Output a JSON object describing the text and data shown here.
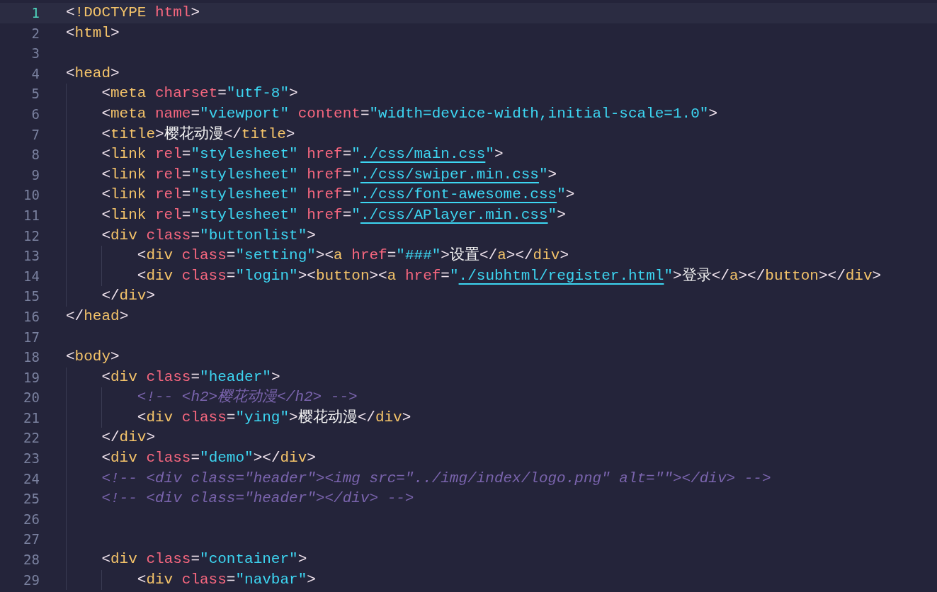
{
  "editor": {
    "lines": [
      {
        "number": "1",
        "current": true,
        "tokens": [
          {
            "kind": "punct",
            "text": "<"
          },
          {
            "kind": "doctype",
            "text": "!DOCTYPE "
          },
          {
            "kind": "attr",
            "text": "html"
          },
          {
            "kind": "punct",
            "text": ">"
          }
        ]
      },
      {
        "number": "2",
        "current": false,
        "tokens": [
          {
            "kind": "punct",
            "text": "<"
          },
          {
            "kind": "tag",
            "text": "html"
          },
          {
            "kind": "punct",
            "text": ">"
          }
        ]
      },
      {
        "number": "3",
        "current": false
      },
      {
        "number": "4",
        "current": false,
        "tokens": [
          {
            "kind": "punct",
            "text": "<"
          },
          {
            "kind": "tag",
            "text": "head"
          },
          {
            "kind": "punct",
            "text": ">"
          }
        ],
        "children": [
          {
            "number": "5",
            "current": false,
            "tokens": [
              {
                "kind": "punct",
                "text": "<"
              },
              {
                "kind": "tag",
                "text": "meta "
              },
              {
                "kind": "attr",
                "text": "charset"
              },
              {
                "kind": "punct",
                "text": "="
              },
              {
                "kind": "string",
                "text": "\"utf-8\""
              },
              {
                "kind": "punct",
                "text": ">"
              }
            ]
          },
          {
            "number": "6",
            "current": false,
            "tokens": [
              {
                "kind": "punct",
                "text": "<"
              },
              {
                "kind": "tag",
                "text": "meta "
              },
              {
                "kind": "attr",
                "text": "name"
              },
              {
                "kind": "punct",
                "text": "="
              },
              {
                "kind": "string",
                "text": "\"viewport\" "
              },
              {
                "kind": "attr",
                "text": "content"
              },
              {
                "kind": "punct",
                "text": "="
              },
              {
                "kind": "string",
                "text": "\"width=device-width,initial-scale=1.0\""
              },
              {
                "kind": "punct",
                "text": ">"
              }
            ]
          },
          {
            "number": "7",
            "current": false,
            "tokens": [
              {
                "kind": "punct",
                "text": "<"
              },
              {
                "kind": "tag",
                "text": "title"
              },
              {
                "kind": "punct",
                "text": ">"
              },
              {
                "kind": "text",
                "text": "樱花动漫"
              },
              {
                "kind": "punct",
                "text": "</"
              },
              {
                "kind": "tag",
                "text": "title"
              },
              {
                "kind": "punct",
                "text": ">"
              }
            ]
          },
          {
            "number": "8",
            "current": false,
            "tokens": [
              {
                "kind": "punct",
                "text": "<"
              },
              {
                "kind": "tag",
                "text": "link "
              },
              {
                "kind": "attr",
                "text": "rel"
              },
              {
                "kind": "punct",
                "text": "="
              },
              {
                "kind": "string",
                "text": "\"stylesheet\" "
              },
              {
                "kind": "attr",
                "text": "href"
              },
              {
                "kind": "punct",
                "text": "="
              },
              {
                "kind": "string",
                "text": "\""
              },
              {
                "kind": "link",
                "text": "./css/main.css"
              },
              {
                "kind": "string",
                "text": "\""
              },
              {
                "kind": "punct",
                "text": ">"
              }
            ]
          },
          {
            "number": "9",
            "current": false,
            "tokens": [
              {
                "kind": "punct",
                "text": "<"
              },
              {
                "kind": "tag",
                "text": "link "
              },
              {
                "kind": "attr",
                "text": "rel"
              },
              {
                "kind": "punct",
                "text": "="
              },
              {
                "kind": "string",
                "text": "\"stylesheet\" "
              },
              {
                "kind": "attr",
                "text": "href"
              },
              {
                "kind": "punct",
                "text": "="
              },
              {
                "kind": "string",
                "text": "\""
              },
              {
                "kind": "link",
                "text": "./css/swiper.min.css"
              },
              {
                "kind": "string",
                "text": "\""
              },
              {
                "kind": "punct",
                "text": ">"
              }
            ]
          },
          {
            "number": "10",
            "current": false,
            "tokens": [
              {
                "kind": "punct",
                "text": "<"
              },
              {
                "kind": "tag",
                "text": "link "
              },
              {
                "kind": "attr",
                "text": "rel"
              },
              {
                "kind": "punct",
                "text": "="
              },
              {
                "kind": "string",
                "text": "\"stylesheet\" "
              },
              {
                "kind": "attr",
                "text": "href"
              },
              {
                "kind": "punct",
                "text": "="
              },
              {
                "kind": "string",
                "text": "\""
              },
              {
                "kind": "link",
                "text": "./css/font-awesome.css"
              },
              {
                "kind": "string",
                "text": "\""
              },
              {
                "kind": "punct",
                "text": ">"
              }
            ]
          },
          {
            "number": "11",
            "current": false,
            "tokens": [
              {
                "kind": "punct",
                "text": "<"
              },
              {
                "kind": "tag",
                "text": "link "
              },
              {
                "kind": "attr",
                "text": "rel"
              },
              {
                "kind": "punct",
                "text": "="
              },
              {
                "kind": "string",
                "text": "\"stylesheet\" "
              },
              {
                "kind": "attr",
                "text": "href"
              },
              {
                "kind": "punct",
                "text": "="
              },
              {
                "kind": "string",
                "text": "\""
              },
              {
                "kind": "link",
                "text": "./css/APlayer.min.css"
              },
              {
                "kind": "string",
                "text": "\""
              },
              {
                "kind": "punct",
                "text": ">"
              }
            ]
          },
          {
            "number": "12",
            "current": false,
            "tokens": [
              {
                "kind": "punct",
                "text": "<"
              },
              {
                "kind": "tag",
                "text": "div "
              },
              {
                "kind": "attr",
                "text": "class"
              },
              {
                "kind": "punct",
                "text": "="
              },
              {
                "kind": "string",
                "text": "\"buttonlist\""
              },
              {
                "kind": "punct",
                "text": ">"
              }
            ],
            "children": [
              {
                "number": "13",
                "current": false,
                "tokens": [
                  {
                    "kind": "punct",
                    "text": "<"
                  },
                  {
                    "kind": "tag",
                    "text": "div "
                  },
                  {
                    "kind": "attr",
                    "text": "class"
                  },
                  {
                    "kind": "punct",
                    "text": "="
                  },
                  {
                    "kind": "string",
                    "text": "\"setting\""
                  },
                  {
                    "kind": "punct",
                    "text": "><"
                  },
                  {
                    "kind": "tag",
                    "text": "a "
                  },
                  {
                    "kind": "attr",
                    "text": "href"
                  },
                  {
                    "kind": "punct",
                    "text": "="
                  },
                  {
                    "kind": "string",
                    "text": "\"###\""
                  },
                  {
                    "kind": "punct",
                    "text": ">"
                  },
                  {
                    "kind": "text",
                    "text": "设置"
                  },
                  {
                    "kind": "punct",
                    "text": "</"
                  },
                  {
                    "kind": "tag",
                    "text": "a"
                  },
                  {
                    "kind": "punct",
                    "text": "></"
                  },
                  {
                    "kind": "tag",
                    "text": "div"
                  },
                  {
                    "kind": "punct",
                    "text": ">"
                  }
                ]
              },
              {
                "number": "14",
                "current": false,
                "tokens": [
                  {
                    "kind": "punct",
                    "text": "<"
                  },
                  {
                    "kind": "tag",
                    "text": "div "
                  },
                  {
                    "kind": "attr",
                    "text": "class"
                  },
                  {
                    "kind": "punct",
                    "text": "="
                  },
                  {
                    "kind": "string",
                    "text": "\"login\""
                  },
                  {
                    "kind": "punct",
                    "text": "><"
                  },
                  {
                    "kind": "tag",
                    "text": "button"
                  },
                  {
                    "kind": "punct",
                    "text": "><"
                  },
                  {
                    "kind": "tag",
                    "text": "a "
                  },
                  {
                    "kind": "attr",
                    "text": "href"
                  },
                  {
                    "kind": "punct",
                    "text": "="
                  },
                  {
                    "kind": "string",
                    "text": "\""
                  },
                  {
                    "kind": "link",
                    "text": "./subhtml/register.html"
                  },
                  {
                    "kind": "string",
                    "text": "\""
                  },
                  {
                    "kind": "punct",
                    "text": ">"
                  },
                  {
                    "kind": "text",
                    "text": "登录"
                  },
                  {
                    "kind": "punct",
                    "text": "</"
                  },
                  {
                    "kind": "tag",
                    "text": "a"
                  },
                  {
                    "kind": "punct",
                    "text": "></"
                  },
                  {
                    "kind": "tag",
                    "text": "button"
                  },
                  {
                    "kind": "punct",
                    "text": "></"
                  },
                  {
                    "kind": "tag",
                    "text": "div"
                  },
                  {
                    "kind": "punct",
                    "text": ">"
                  }
                ]
              }
            ]
          },
          {
            "number": "15",
            "current": false,
            "tokens": [
              {
                "kind": "punct",
                "text": "</"
              },
              {
                "kind": "tag",
                "text": "div"
              },
              {
                "kind": "punct",
                "text": ">"
              }
            ]
          }
        ]
      },
      {
        "number": "16",
        "current": false,
        "tokens": [
          {
            "kind": "punct",
            "text": "</"
          },
          {
            "kind": "tag",
            "text": "head"
          },
          {
            "kind": "punct",
            "text": ">"
          }
        ]
      },
      {
        "number": "17",
        "current": false
      },
      {
        "number": "18",
        "current": false,
        "tokens": [
          {
            "kind": "punct",
            "text": "<"
          },
          {
            "kind": "tag",
            "text": "body"
          },
          {
            "kind": "punct",
            "text": ">"
          }
        ],
        "children": [
          {
            "number": "19",
            "current": false,
            "tokens": [
              {
                "kind": "punct",
                "text": "<"
              },
              {
                "kind": "tag",
                "text": "div "
              },
              {
                "kind": "attr",
                "text": "class"
              },
              {
                "kind": "punct",
                "text": "="
              },
              {
                "kind": "string",
                "text": "\"header\""
              },
              {
                "kind": "punct",
                "text": ">"
              }
            ],
            "children": [
              {
                "number": "20",
                "current": false,
                "tokens": [
                  {
                    "kind": "comment",
                    "text": "<!-- <h2>樱花动漫</h2> -->"
                  }
                ]
              },
              {
                "number": "21",
                "current": false,
                "tokens": [
                  {
                    "kind": "punct",
                    "text": "<"
                  },
                  {
                    "kind": "tag",
                    "text": "div "
                  },
                  {
                    "kind": "attr",
                    "text": "class"
                  },
                  {
                    "kind": "punct",
                    "text": "="
                  },
                  {
                    "kind": "string",
                    "text": "\"ying\""
                  },
                  {
                    "kind": "punct",
                    "text": ">"
                  },
                  {
                    "kind": "text",
                    "text": "樱花动漫"
                  },
                  {
                    "kind": "punct",
                    "text": "</"
                  },
                  {
                    "kind": "tag",
                    "text": "div"
                  },
                  {
                    "kind": "punct",
                    "text": ">"
                  }
                ]
              }
            ]
          },
          {
            "number": "22",
            "current": false,
            "tokens": [
              {
                "kind": "punct",
                "text": "</"
              },
              {
                "kind": "tag",
                "text": "div"
              },
              {
                "kind": "punct",
                "text": ">"
              }
            ]
          },
          {
            "number": "23",
            "current": false,
            "tokens": [
              {
                "kind": "punct",
                "text": "<"
              },
              {
                "kind": "tag",
                "text": "div "
              },
              {
                "kind": "attr",
                "text": "class"
              },
              {
                "kind": "punct",
                "text": "="
              },
              {
                "kind": "string",
                "text": "\"demo\""
              },
              {
                "kind": "punct",
                "text": "></"
              },
              {
                "kind": "tag",
                "text": "div"
              },
              {
                "kind": "punct",
                "text": ">"
              }
            ]
          },
          {
            "number": "24",
            "current": false,
            "tokens": [
              {
                "kind": "comment",
                "text": "<!-- <div class=\"header\"><img src=\"../img/index/logo.png\" alt=\"\"></div> -->"
              }
            ]
          },
          {
            "number": "25",
            "current": false,
            "tokens": [
              {
                "kind": "comment",
                "text": "<!-- <div class=\"header\"></div> -->"
              }
            ]
          },
          {
            "number": "26",
            "current": false
          },
          {
            "number": "27",
            "current": false
          },
          {
            "number": "28",
            "current": false,
            "tokens": [
              {
                "kind": "punct",
                "text": "<"
              },
              {
                "kind": "tag",
                "text": "div "
              },
              {
                "kind": "attr",
                "text": "class"
              },
              {
                "kind": "punct",
                "text": "="
              },
              {
                "kind": "string",
                "text": "\"container\""
              },
              {
                "kind": "punct",
                "text": ">"
              }
            ],
            "children": [
              {
                "number": "29",
                "current": false,
                "tokens": [
                  {
                    "kind": "punct",
                    "text": "<"
                  },
                  {
                    "kind": "tag",
                    "text": "div "
                  },
                  {
                    "kind": "attr",
                    "text": "class"
                  },
                  {
                    "kind": "punct",
                    "text": "="
                  },
                  {
                    "kind": "string",
                    "text": "\"navbar\""
                  },
                  {
                    "kind": "punct",
                    "text": ">"
                  }
                ]
              }
            ]
          }
        ]
      }
    ]
  }
}
